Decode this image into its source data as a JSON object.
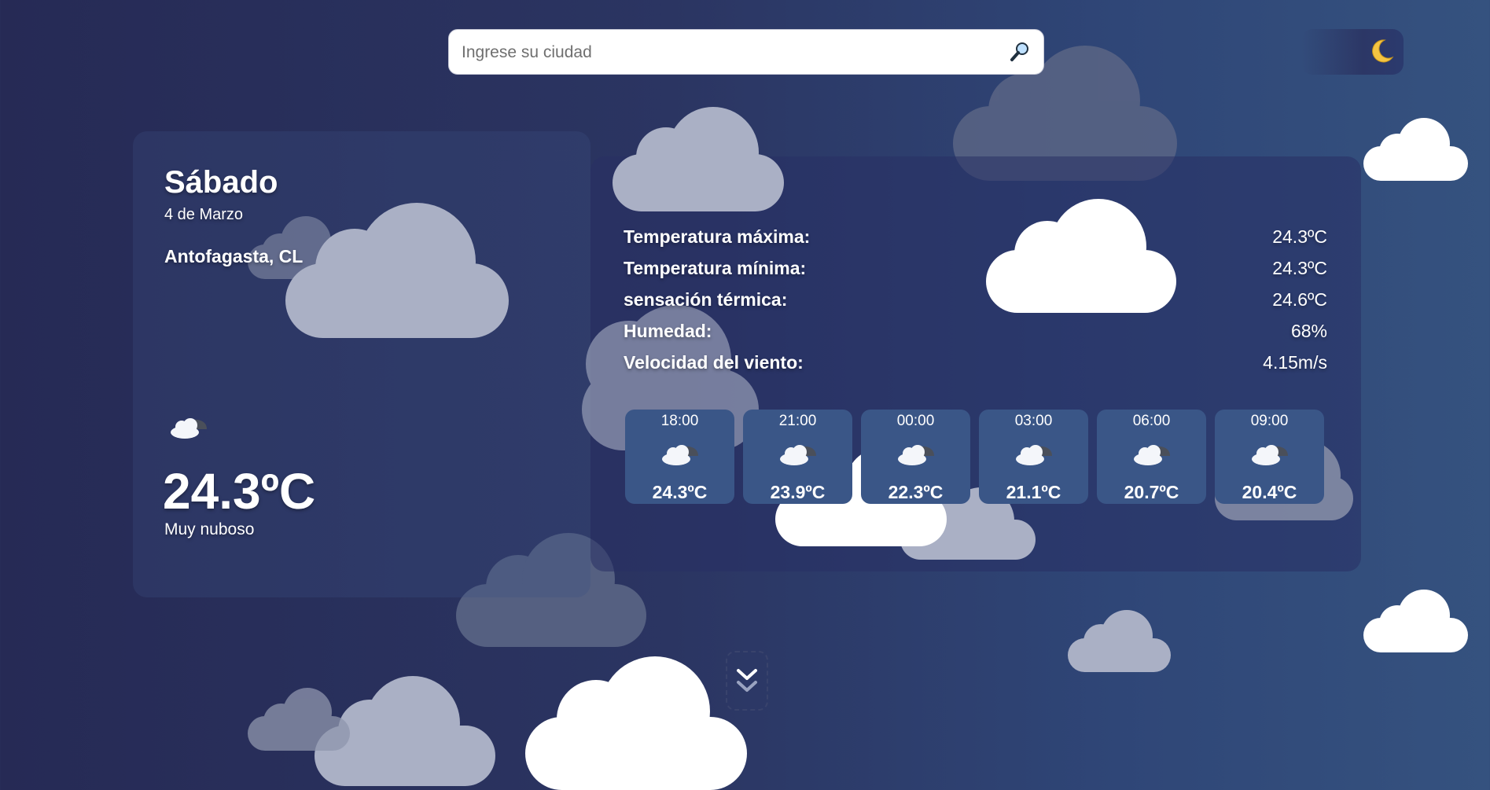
{
  "search": {
    "placeholder": "Ingrese su ciudad",
    "icon": "magnifier-icon"
  },
  "theme_toggle": {
    "icon": "crescent-moon-icon",
    "mode": "dark"
  },
  "current": {
    "day": "Sábado",
    "date": "4 de Marzo",
    "location": "Antofagasta, CL",
    "icon": "cloud-sun-icon",
    "temperature": "24.3ºC",
    "description": "Muy nuboso"
  },
  "details": [
    {
      "label": "Temperatura máxima:",
      "value": "24.3ºC"
    },
    {
      "label": "Temperatura mínima:",
      "value": "24.3ºC"
    },
    {
      "label": "sensación térmica:",
      "value": "24.6ºC"
    },
    {
      "label": "Humedad:",
      "value": "68%"
    },
    {
      "label": "Velocidad del viento:",
      "value": "4.15m/s"
    }
  ],
  "hourly": [
    {
      "time": "18:00",
      "temp": "24.3ºC",
      "icon": "cloud-sun-icon"
    },
    {
      "time": "21:00",
      "temp": "23.9ºC",
      "icon": "cloud-sun-icon"
    },
    {
      "time": "00:00",
      "temp": "22.3ºC",
      "icon": "cloud-sun-icon"
    },
    {
      "time": "03:00",
      "temp": "21.1ºC",
      "icon": "cloud-sun-icon"
    },
    {
      "time": "06:00",
      "temp": "20.7ºC",
      "icon": "cloud-sun-icon"
    },
    {
      "time": "09:00",
      "temp": "20.4ºC",
      "icon": "cloud-sun-icon"
    }
  ],
  "scroll_down": {
    "icon": "double-chevron-down-icon"
  },
  "colors": {
    "background": "#2b3562",
    "card": "#3a5687",
    "text": "#ffffff"
  }
}
